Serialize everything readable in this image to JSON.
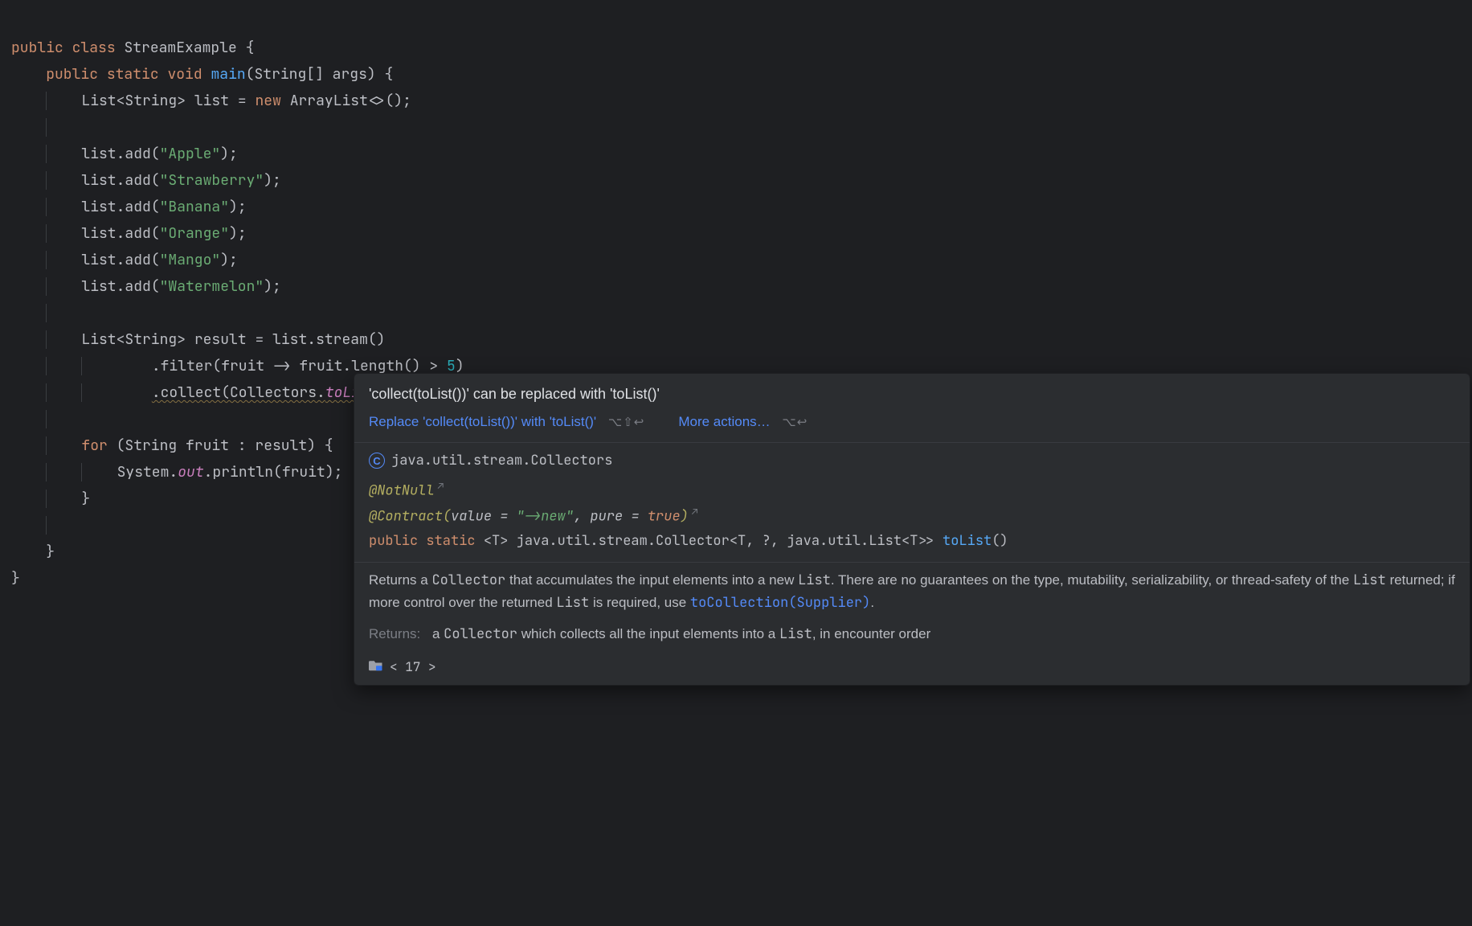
{
  "code": {
    "kw_public": "public",
    "kw_class": "class",
    "class_name": "StreamExample",
    "kw_static": "static",
    "kw_void": "void",
    "fn_main": "main",
    "main_params": "(String[] args)",
    "list_decl_type": "List<String>",
    "list_decl_name": "list",
    "kw_new": "new",
    "arraylist": "ArrayList<>()",
    "add_apple": "\"Apple\"",
    "add_strawberry": "\"Strawberry\"",
    "add_banana": "\"Banana\"",
    "add_orange": "\"Orange\"",
    "add_mango": "\"Mango\"",
    "add_watermelon": "\"Watermelon\"",
    "result_decl_type": "List<String>",
    "result_decl_name": "result",
    "stream_call": "list.stream()",
    "filter_call": ".filter(fruit -> fruit.length() > ",
    "filter_num": "5",
    "filter_close": ")",
    "collect_call": ".collect(Collectors.",
    "collect_tolist": "toList",
    "collect_close": "())",
    "kw_for": "for",
    "for_header": " (String fruit : result) {",
    "println_sys": "System.",
    "println_out": "out",
    "println_rest": ".println(fruit)",
    "list_add_prefix": "list.add("
  },
  "popup": {
    "inspection_title": "'collect(toList())' can be replaced with 'toList()'",
    "fix_label": "Replace 'collect(toList())' with 'toList()'",
    "fix_shortcut": "⌥⇧↩",
    "more_actions": "More actions…",
    "more_shortcut": "⌥↩",
    "class_fqn": "java.util.stream.Collectors",
    "anno_notnull": "@NotNull",
    "anno_contract": "@Contract",
    "contract_value_key": "value",
    "contract_value_val": "\"->new\"",
    "contract_pure_key": "pure",
    "contract_pure_val": "true",
    "sig_public": "public",
    "sig_static": "static",
    "sig_generic": "<T>",
    "sig_return": "java.util.stream.Collector<T, ?, java.util.List<T>>",
    "sig_name": "toList",
    "sig_params": "()",
    "doc_pre1": "Returns a ",
    "doc_code1": "Collector",
    "doc_mid1": " that accumulates the input elements into a new ",
    "doc_code2": "List",
    "doc_mid2": ". There are no guarantees on the type, mutability, serializability, or thread-safety of the ",
    "doc_code3": "List",
    "doc_mid3": " returned; if more control over the returned ",
    "doc_code4": "List",
    "doc_mid4": " is required, use ",
    "doc_link": "toCollection(Supplier)",
    "doc_end": ".",
    "returns_label": "Returns:",
    "returns_pre": "a ",
    "returns_code1": "Collector",
    "returns_mid": " which collects all the input elements into a ",
    "returns_code2": "List",
    "returns_end": ", in encounter order",
    "footer_text": "< 17 >"
  }
}
